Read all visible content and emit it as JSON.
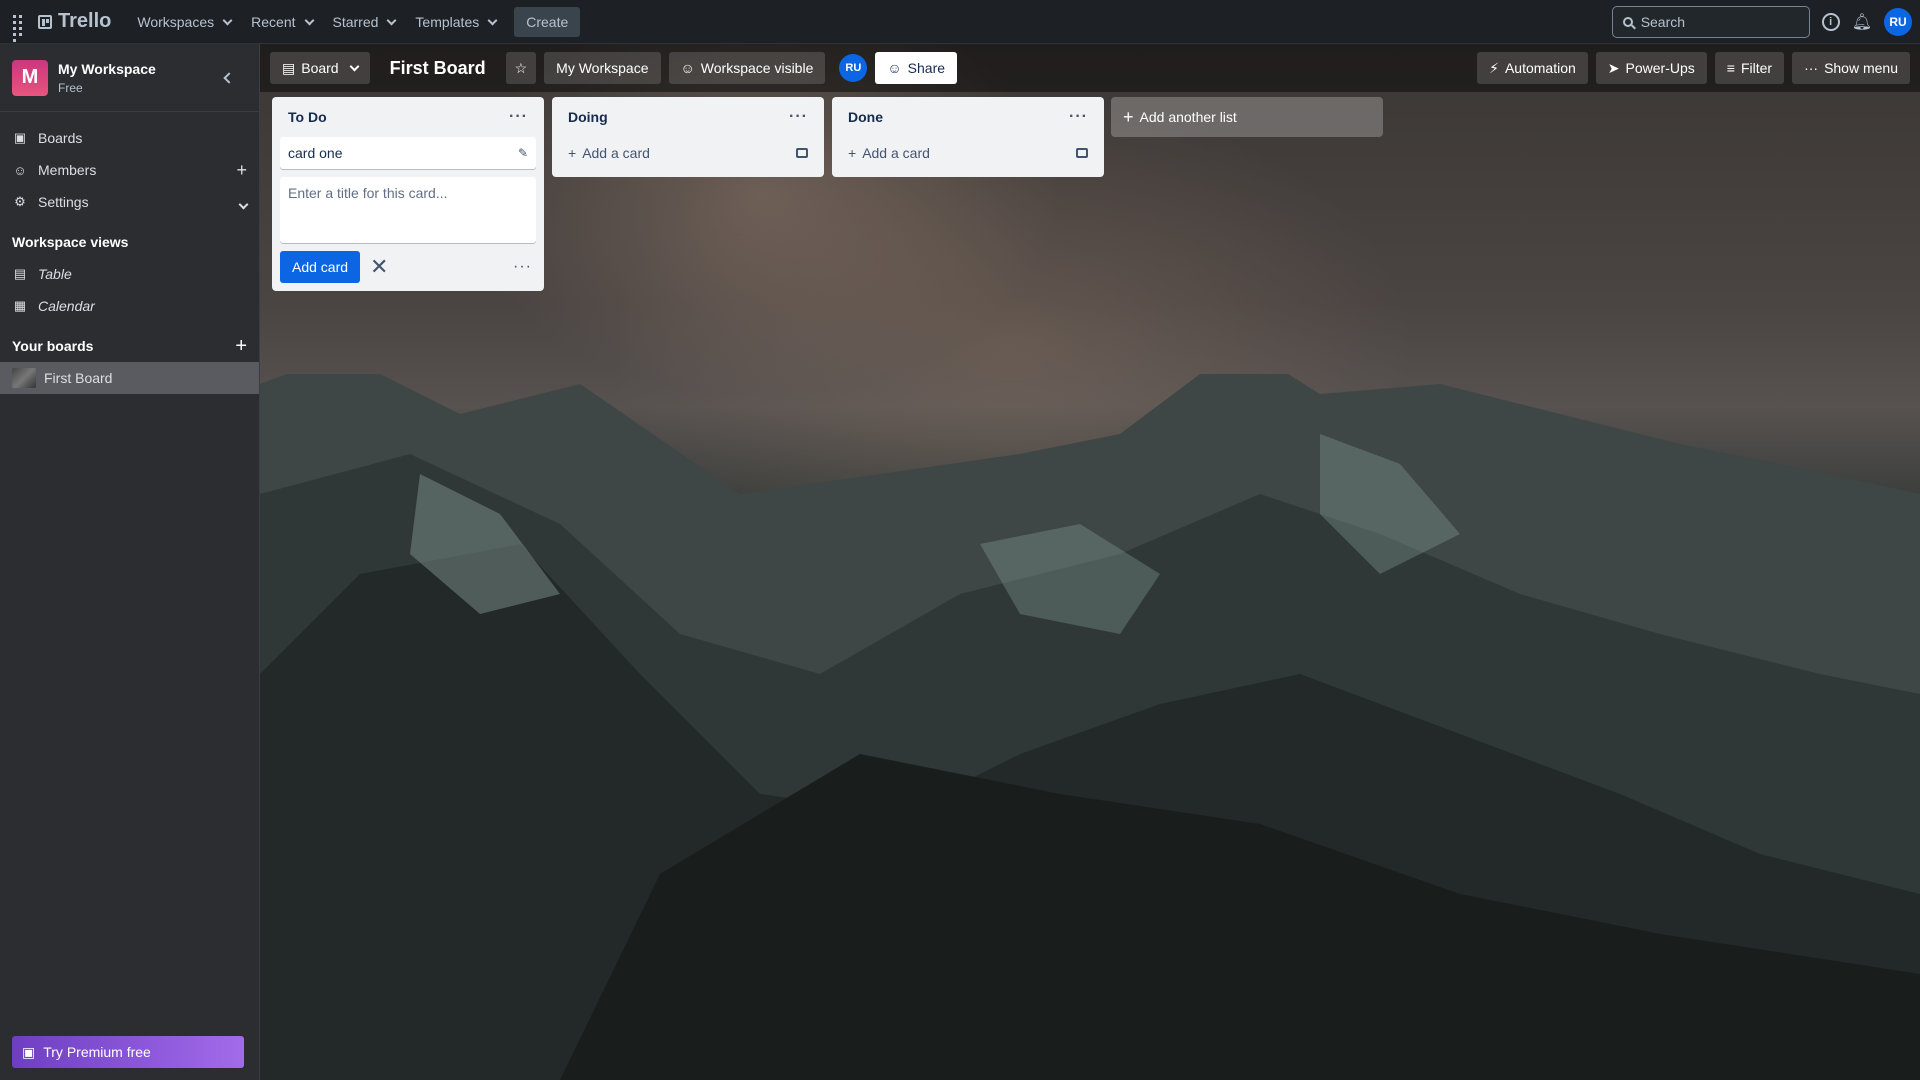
{
  "topnav": {
    "logo": "Trello",
    "menus": [
      "Workspaces",
      "Recent",
      "Starred",
      "Templates"
    ],
    "create": "Create",
    "search_placeholder": "Search",
    "avatar": "RU"
  },
  "sidebar": {
    "workspace_initial": "M",
    "workspace_name": "My Workspace",
    "workspace_plan": "Free",
    "items": [
      {
        "label": "Boards",
        "icon": "board-icon"
      },
      {
        "label": "Members",
        "icon": "person-icon"
      },
      {
        "label": "Settings",
        "icon": "gear-icon"
      }
    ],
    "views_title": "Workspace views",
    "views": [
      {
        "label": "Table",
        "icon": "table-icon"
      },
      {
        "label": "Calendar",
        "icon": "calendar-icon"
      }
    ],
    "boards_title": "Your boards",
    "boards": [
      {
        "label": "First Board"
      }
    ],
    "premium": "Try Premium free"
  },
  "boardbar": {
    "view": "Board",
    "title": "First Board",
    "workspace": "My Workspace",
    "visibility": "Workspace visible",
    "member": "RU",
    "share": "Share",
    "automation": "Automation",
    "powerups": "Power-Ups",
    "filter": "Filter",
    "show_menu": "Show menu"
  },
  "lists": [
    {
      "title": "To Do",
      "cards": [
        "card one"
      ],
      "composer_placeholder": "Enter a title for this card...",
      "add_button": "Add card"
    },
    {
      "title": "Doing",
      "add_card": "Add a card"
    },
    {
      "title": "Done",
      "add_card": "Add a card"
    }
  ],
  "add_list": "Add another list",
  "colors": {
    "accent": "#0c66e4",
    "nav_bg": "#1d2125",
    "sidebar_bg": "#2b2d31",
    "list_bg": "#f1f2f4"
  }
}
